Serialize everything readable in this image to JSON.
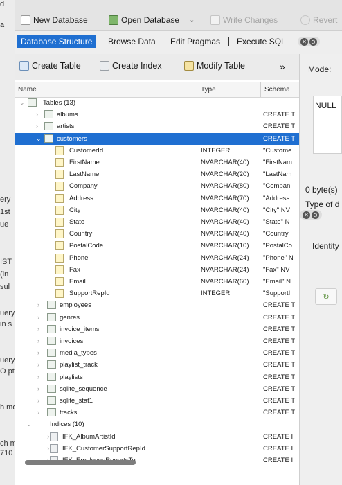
{
  "background_app": {
    "fragments": [
      "d",
      "a",
      "ery",
      "1st",
      "ue",
      "IST",
      "(in",
      "sul",
      "uery",
      "in s",
      "uery",
      "O pt",
      "h mo",
      "ch mo",
      "710"
    ]
  },
  "toolbar_top": {
    "new_database": "New Database",
    "open_database": "Open Database",
    "write_changes": "Write Changes",
    "revert": "Revert"
  },
  "tabs": {
    "items": [
      "Database Structure",
      "Browse Data",
      "Edit Pragmas",
      "Execute SQL"
    ],
    "active": "Database Structure"
  },
  "structure_toolbar": {
    "create_table": "Create Table",
    "create_index": "Create Index",
    "modify_table": "Modify Table",
    "overflow": "»"
  },
  "columns": {
    "name": "Name",
    "type": "Type",
    "schema": "Schema"
  },
  "rows": [
    {
      "kind": "group",
      "arrow": "⌄",
      "name": "Tables (13)",
      "type": "",
      "schema": ""
    },
    {
      "kind": "table",
      "arrow": "›",
      "name": "albums",
      "type": "",
      "schema": "CREATE T"
    },
    {
      "kind": "table",
      "arrow": "›",
      "name": "artists",
      "type": "",
      "schema": "CREATE T"
    },
    {
      "kind": "table",
      "arrow": "⌄",
      "name": "customers",
      "type": "",
      "schema": "CREATE T",
      "selected": true
    },
    {
      "kind": "field",
      "arrow": "",
      "name": "CustomerId",
      "type": "INTEGER",
      "schema": "\"Custome"
    },
    {
      "kind": "field",
      "arrow": "",
      "name": "FirstName",
      "type": "NVARCHAR(40)",
      "schema": "\"FirstNam"
    },
    {
      "kind": "field",
      "arrow": "",
      "name": "LastName",
      "type": "NVARCHAR(20)",
      "schema": "\"LastNam"
    },
    {
      "kind": "field",
      "arrow": "",
      "name": "Company",
      "type": "NVARCHAR(80)",
      "schema": "\"Compan"
    },
    {
      "kind": "field",
      "arrow": "",
      "name": "Address",
      "type": "NVARCHAR(70)",
      "schema": "\"Address"
    },
    {
      "kind": "field",
      "arrow": "",
      "name": "City",
      "type": "NVARCHAR(40)",
      "schema": "\"City\" NV"
    },
    {
      "kind": "field",
      "arrow": "",
      "name": "State",
      "type": "NVARCHAR(40)",
      "schema": "\"State\" N"
    },
    {
      "kind": "field",
      "arrow": "",
      "name": "Country",
      "type": "NVARCHAR(40)",
      "schema": "\"Country"
    },
    {
      "kind": "field",
      "arrow": "",
      "name": "PostalCode",
      "type": "NVARCHAR(10)",
      "schema": "\"PostalCo"
    },
    {
      "kind": "field",
      "arrow": "",
      "name": "Phone",
      "type": "NVARCHAR(24)",
      "schema": "\"Phone\" N"
    },
    {
      "kind": "field",
      "arrow": "",
      "name": "Fax",
      "type": "NVARCHAR(24)",
      "schema": "\"Fax\" NV"
    },
    {
      "kind": "field",
      "arrow": "",
      "name": "Email",
      "type": "NVARCHAR(60)",
      "schema": "\"Email\" N"
    },
    {
      "kind": "field",
      "arrow": "",
      "name": "SupportRepId",
      "type": "INTEGER",
      "schema": "\"SupportI"
    },
    {
      "kind": "table",
      "arrow": "›",
      "name": "employees",
      "type": "",
      "schema": "CREATE T"
    },
    {
      "kind": "table",
      "arrow": "›",
      "name": "genres",
      "type": "",
      "schema": "CREATE T"
    },
    {
      "kind": "table",
      "arrow": "›",
      "name": "invoice_items",
      "type": "",
      "schema": "CREATE T"
    },
    {
      "kind": "table",
      "arrow": "›",
      "name": "invoices",
      "type": "",
      "schema": "CREATE T"
    },
    {
      "kind": "table",
      "arrow": "›",
      "name": "media_types",
      "type": "",
      "schema": "CREATE T"
    },
    {
      "kind": "table",
      "arrow": "›",
      "name": "playlist_track",
      "type": "",
      "schema": "CREATE T"
    },
    {
      "kind": "table",
      "arrow": "›",
      "name": "playlists",
      "type": "",
      "schema": "CREATE T"
    },
    {
      "kind": "table",
      "arrow": "›",
      "name": "sqlite_sequence",
      "type": "",
      "schema": "CREATE T"
    },
    {
      "kind": "table",
      "arrow": "›",
      "name": "sqlite_stat1",
      "type": "",
      "schema": "CREATE T"
    },
    {
      "kind": "table",
      "arrow": "›",
      "name": "tracks",
      "type": "",
      "schema": "CREATE T"
    },
    {
      "kind": "group",
      "arrow": "⌄",
      "name": "Indices (10)",
      "type": "",
      "schema": ""
    },
    {
      "kind": "index",
      "arrow": "›",
      "name": "IFK_AlbumArtistId",
      "type": "",
      "schema": "CREATE I"
    },
    {
      "kind": "index",
      "arrow": "›",
      "name": "IFK_CustomerSupportRepId",
      "type": "",
      "schema": "CREATE I"
    },
    {
      "kind": "index",
      "arrow": "›",
      "name": "IFK_EmployeeReportsTo",
      "type": "",
      "schema": "CREATE I"
    }
  ],
  "right_pane": {
    "mode_label": "Mode:",
    "null_value": "NULL",
    "type_of": "Type of d",
    "size": "0 byte(s)",
    "identity": "Identity"
  },
  "colors": {
    "accent": "#1f6fd1"
  }
}
